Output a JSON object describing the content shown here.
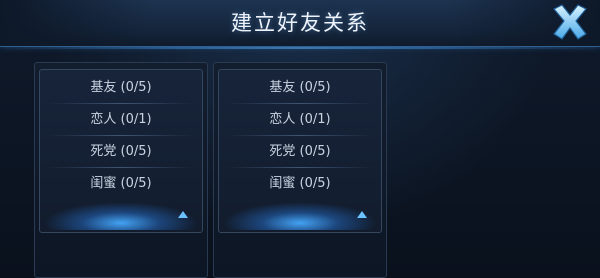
{
  "dialog": {
    "title": "建立好友关系"
  },
  "panels": [
    {
      "options": [
        "基友 (0/5)",
        "恋人 (0/1)",
        "死党 (0/5)",
        "闺蜜 (0/5)"
      ]
    },
    {
      "options": [
        "基友 (0/5)",
        "恋人 (0/1)",
        "死党 (0/5)",
        "闺蜜 (0/5)"
      ]
    }
  ],
  "colors": {
    "accent": "#4aa8ff",
    "close_icon": "#7fd3ff",
    "text": "#c9d4e2"
  },
  "icons": {
    "close": "close-icon",
    "expand": "chevron-up-icon"
  }
}
